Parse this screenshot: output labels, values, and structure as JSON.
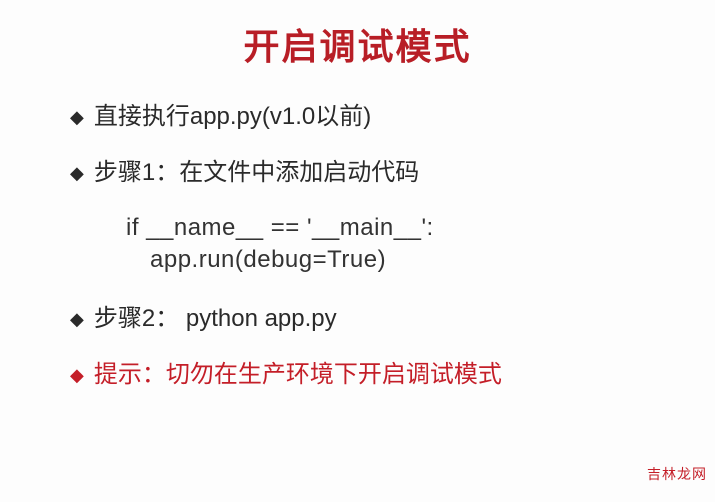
{
  "title": "开启调试模式",
  "items": [
    {
      "bullet": "◆",
      "text": "直接执行app.py(v1.0以前)",
      "warning": false
    },
    {
      "bullet": "◆",
      "text": "步骤1：在文件中添加启动代码",
      "warning": false
    }
  ],
  "code": {
    "line1": "if __name__ == '__main__':",
    "line2": "app.run(debug=True)"
  },
  "items2": [
    {
      "bullet": "◆",
      "text": "步骤2：  python app.py",
      "warning": false
    },
    {
      "bullet": "◆",
      "text": "提示：切勿在生产环境下开启调试模式",
      "warning": true
    }
  ],
  "watermark": "吉林龙网"
}
